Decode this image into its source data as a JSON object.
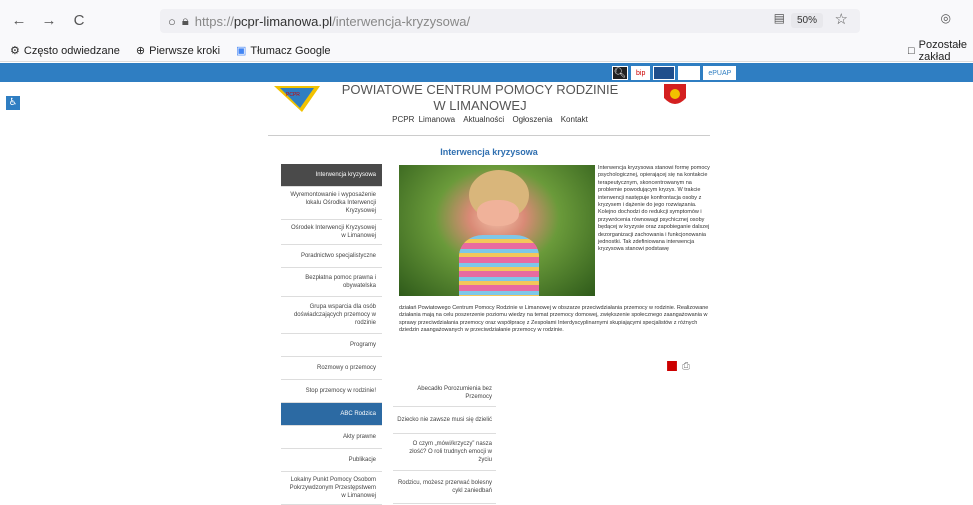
{
  "browser": {
    "back": "←",
    "forward": "→",
    "reload": "C",
    "url_proto": "https://",
    "url_host": "pcpr-limanowa.pl",
    "url_path": "/interwencja-kryzysowa/",
    "zoom": "50%"
  },
  "bookmarks": {
    "often": "Często odwiedzane",
    "first_steps": "Pierwsze kroki",
    "translate": "Tłumacz Google",
    "other": "Pozostałe zakład"
  },
  "site": {
    "title_line1": "POWIATOWE CENTRUM POMOCY RODZINIE",
    "title_line2": "W LIMANOWEJ",
    "nav": [
      "PCPR Limanowa",
      "Aktualności",
      "Ogłoszenia",
      "Kontakt"
    ],
    "page_heading": "Interwencja kryzysowa",
    "top_icons": [
      "bip",
      "",
      "",
      "ePUAP"
    ]
  },
  "sidebar": [
    "Interwencja kryzysowa",
    "Wyremontowanie i wyposażenie lokalu Ośrodka Interwencji Kryzysowej",
    "Ośrodek Interwencji Kryzysowej w Limanowej",
    "Poradnictwo specjalistyczne",
    "Bezpłatna pomoc prawna i obywatelska",
    "Grupa wsparcia dla osób doświadczających przemocy w rodzinie",
    "Programy",
    "Rozmowy o przemocy",
    "Stop przemocy w rodzinie!",
    "ABC Rodzica",
    "Akty prawne",
    "Publikacje",
    "Lokalny Punkt Pomocy Osobom Pokrzywdzonym Przestępstwem w Limanowej"
  ],
  "submenu": [
    "Abecadło Porozumienia bez Przemocy",
    "Dziecko nie zawsze musi się dzielić",
    "O czym „mówi/krzyczy” nasza złość? O roli trudnych emocji w życiu",
    "Rodzicu, możesz przerwać bolesny cykl zaniedbań"
  ],
  "content": {
    "right_text": "Interwencja kryzysowa stanowi formę pomocy psychologicznej, opierającej się na kontakcie terapeutycznym, skoncentrowanym na problemie powodującym kryzys. W trakcie interwencji następuje konfrontacja osoby z kryzysem i dążenie do jego rozwiązania. Kolejno dochodzi do redukcji symptomów i przywrócenia równowagi psychicznej osoby będącej w kryzysie oraz zapobieganie dalszej dezorganizacji zachowania i funkcjonowania jednostki. Tak zdefiniowana interwencja kryzysowa stanowi podstawę",
    "body_text": "działań Powiatowego Centrum Pomocy Rodzinie w Limanowej w obszarze przeciwdziałania przemocy w rodzinie. Realizowane działania mają na celu poszerzenie poziomu wiedzy na temat przemocy domowej, zwiększenie społecznego zaangażowania w sprawy przeciwdziałania przemocy oraz współpracę z Zespołami Interdyscyplinarnymi skupiającymi specjalistów z różnych dziedzin zaangażowanych w przeciwdziałanie przemocy w rodzinie."
  },
  "colors": {
    "blue_strip": "#2f7ec2",
    "heading": "#2f6fb0",
    "sidebar_active": "#4a4a4a",
    "sidebar_blue": "#2c6aa3"
  }
}
